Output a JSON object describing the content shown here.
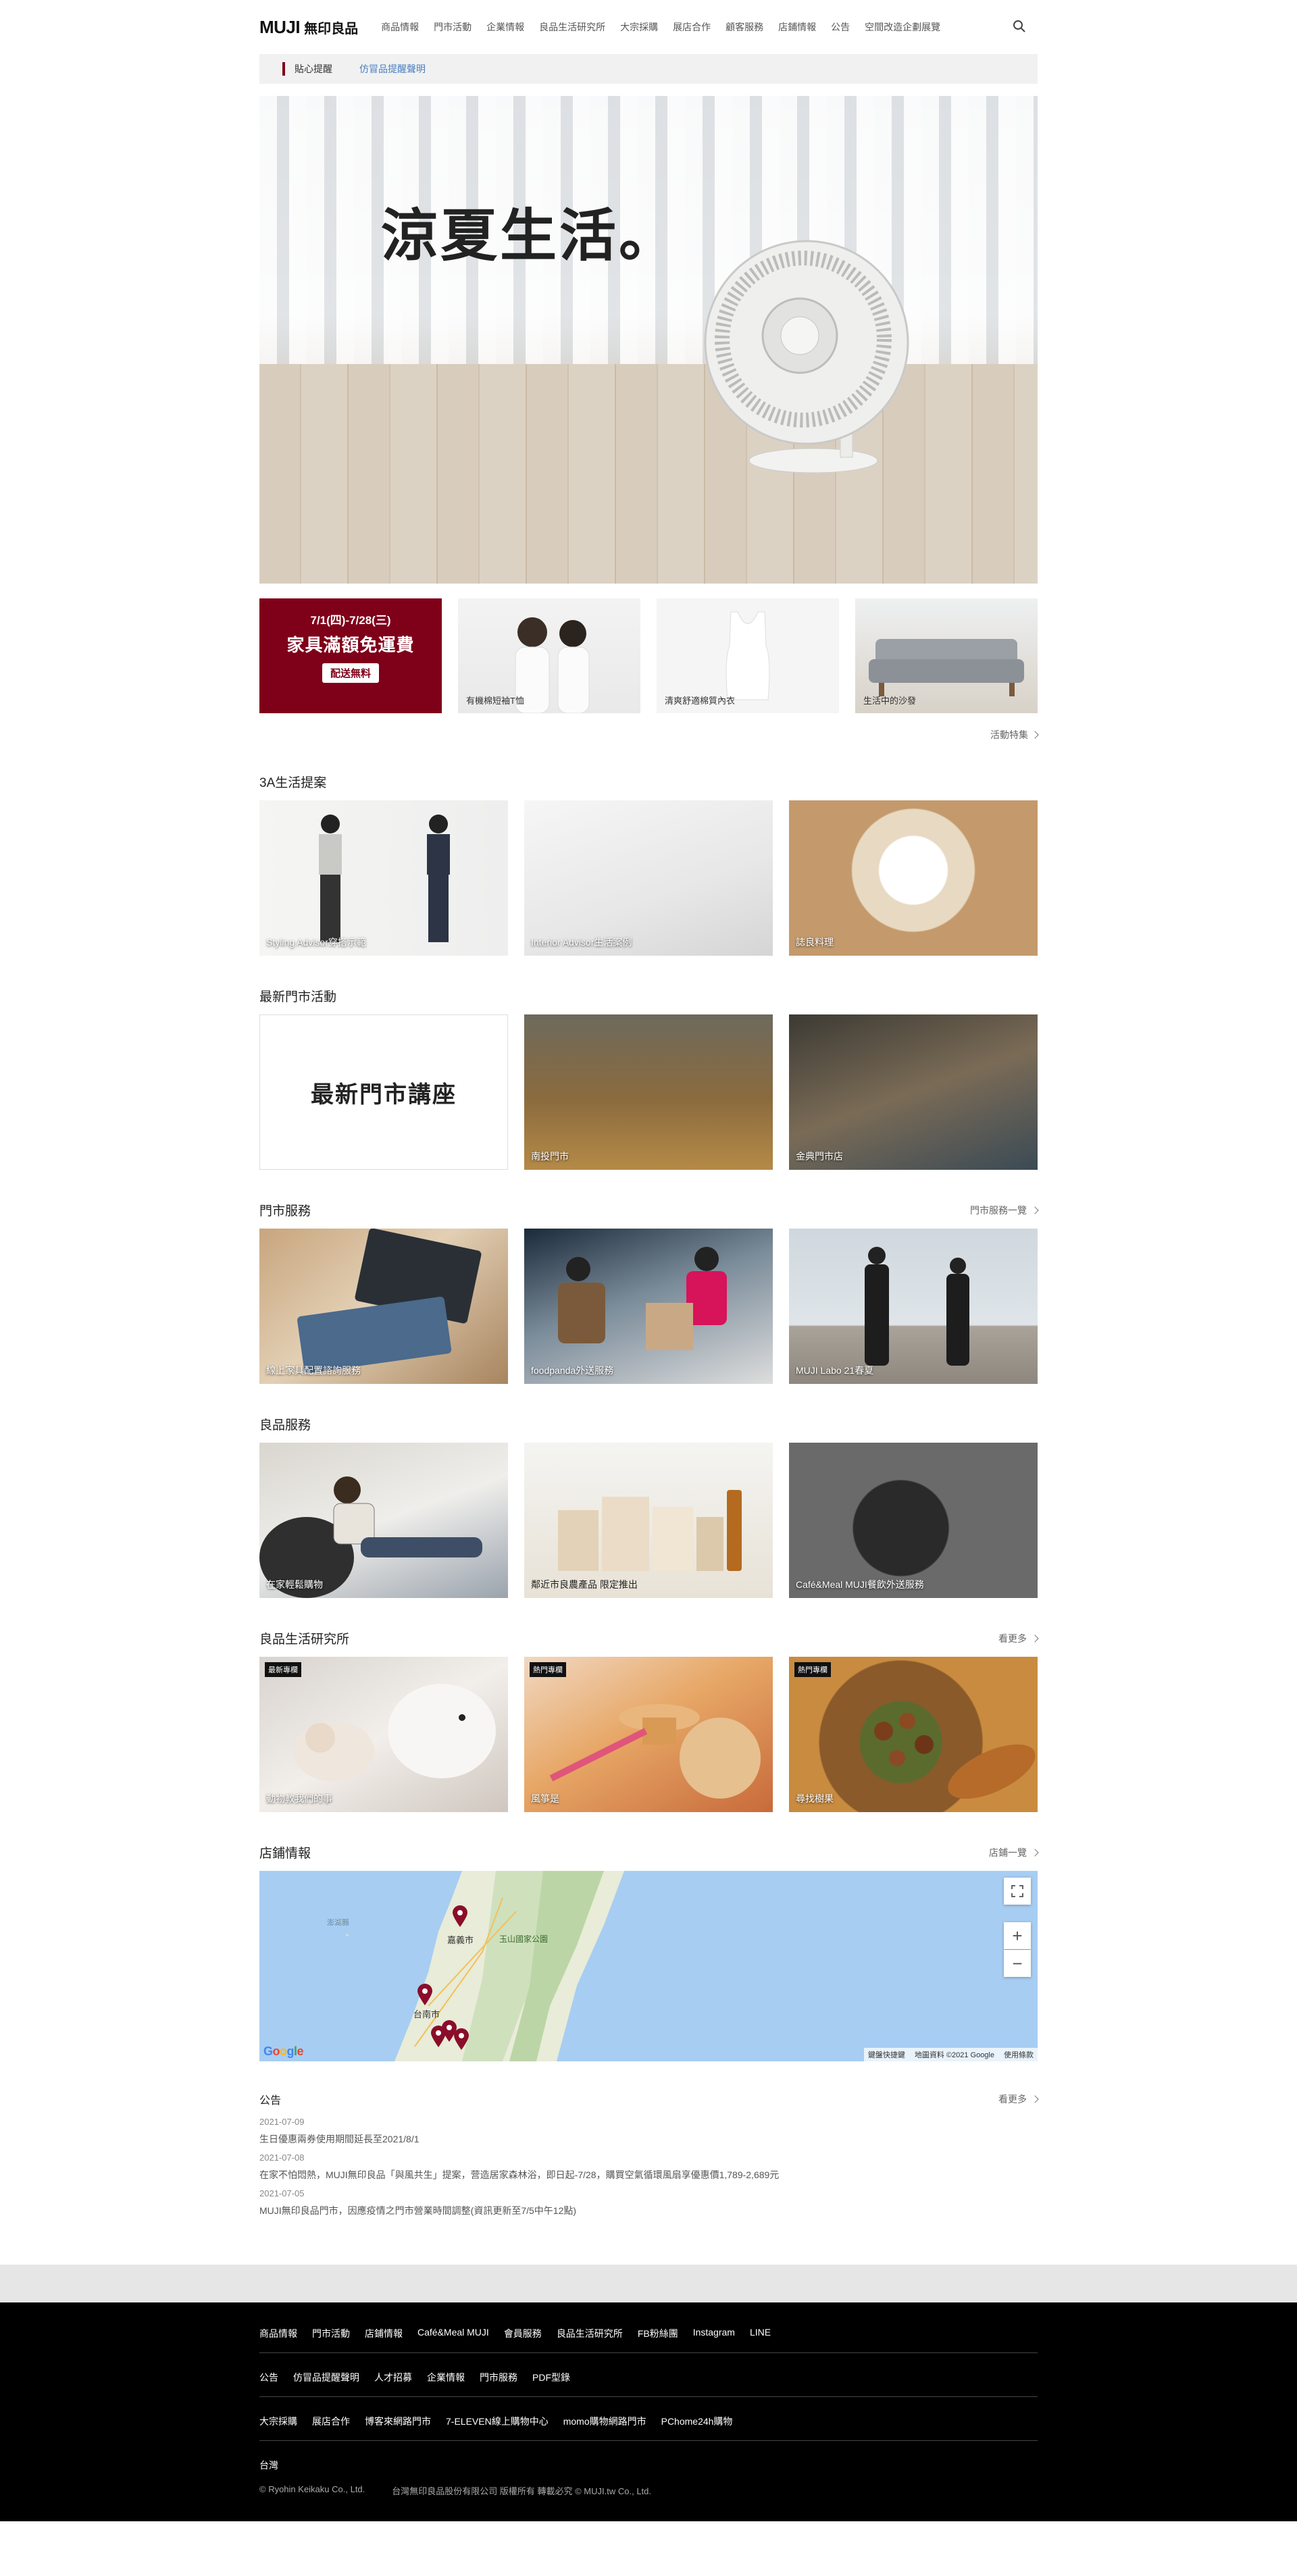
{
  "header": {
    "logo_en": "MUJI",
    "logo_zh": "無印良品",
    "nav": [
      "商品情報",
      "門市活動",
      "企業情報",
      "良品生活研究所",
      "大宗採購",
      "展店合作",
      "顧客服務",
      "店鋪情報",
      "公告",
      "空間改造企劃展覽"
    ]
  },
  "notice": {
    "label": "貼心提醒",
    "link": "仿冒品提醒聲明"
  },
  "hero": {
    "title": "涼夏生活。"
  },
  "promos": [
    {
      "date": "7/1(四)-7/28(三)",
      "main": "家具滿額免運費",
      "badge": "配送無料"
    },
    {
      "caption": "有機棉短袖T恤"
    },
    {
      "caption": "清爽舒適棉質內衣"
    },
    {
      "caption": "生活中的沙發"
    }
  ],
  "promo_more": "活動特集",
  "sections": {
    "life": {
      "title": "3A生活提案",
      "cards": [
        "Styling Advisor穿搭示範",
        "Interior Advisor生活案例",
        "誌良料理"
      ]
    },
    "events": {
      "title": "最新門市活動",
      "lecture": "最新門市講座",
      "cards": [
        "南投門市",
        "金典門市店"
      ]
    },
    "store_service": {
      "title": "門市服務",
      "more": "門市服務一覽",
      "cards": [
        "線上家具配置諮詢服務",
        "foodpanda外送服務",
        "MUJI Labo 21春夏"
      ]
    },
    "goods_service": {
      "title": "良品服務",
      "cards": [
        "在家輕鬆購物",
        "鄰近市良農產品 限定推出",
        "Café&Meal MUJI餐飲外送服務"
      ]
    },
    "lab": {
      "title": "良品生活研究所",
      "more": "看更多",
      "cards": [
        {
          "tag": "最新專欄",
          "caption": "動物教我們的事"
        },
        {
          "tag": "熱門專欄",
          "caption": "風箏是"
        },
        {
          "tag": "熱門專欄",
          "caption": "尋找樹果"
        }
      ]
    },
    "stores": {
      "title": "店鋪情報",
      "more": "店鋪一覽",
      "map_labels": [
        "嘉義市",
        "台南市",
        "玉山國家公園",
        "澎湖縣"
      ],
      "map_footer": [
        "鍵盤快捷鍵",
        "地圖資料 ©2021 Google",
        "使用條款"
      ],
      "google": "Google"
    }
  },
  "announcements": {
    "title": "公告",
    "more": "看更多",
    "items": [
      {
        "date": "2021-07-09",
        "text": "生日優惠兩券使用期間延長至2021/8/1"
      },
      {
        "date": "2021-07-08",
        "text": "在家不怕悶熱，MUJI無印良品「與風共生」提案，营造居家森林浴，即日起-7/28，購買空氣循環風扇享優惠價1,789-2,689元"
      },
      {
        "date": "2021-07-05",
        "text": "MUJI無印良品門市，因應疫情之門市營業時間調整(資訊更新至7/5中午12點)"
      }
    ]
  },
  "footer": {
    "row1": [
      "商品情報",
      "門市活動",
      "店鋪情報",
      "Café&Meal MUJI",
      "會員服務",
      "良品生活研究所",
      "FB粉絲團",
      "Instagram",
      "LINE"
    ],
    "row2": [
      "公告",
      "仿冒品提醒聲明",
      "人才招募",
      "企業情報",
      "門市服務",
      "PDF型錄"
    ],
    "row3": [
      "大宗採購",
      "展店合作",
      "博客來網路門市",
      "7-ELEVEN線上購物中心",
      "momo購物網路門市",
      "PChome24h購物"
    ],
    "row4": [
      "台灣"
    ],
    "copyright1": "© Ryohin Keikaku Co., Ltd.",
    "copyright2": "台灣無印良品股份有限公司 版權所有 轉載必究 © MUJI.tw Co., Ltd."
  }
}
